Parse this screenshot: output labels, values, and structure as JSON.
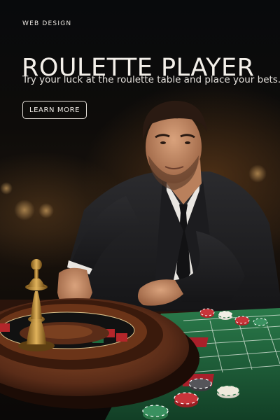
{
  "banner": {
    "eyebrow": "WEB DESIGN",
    "title": "ROULETTE PLAYER",
    "subtitle": "Try your luck at the roulette table and place your bets.",
    "cta_label": "LEARN MORE"
  },
  "colors": {
    "background": "#0b0806",
    "text": "#f4f0ea",
    "felt_green": "#1f6b3e",
    "wheel_wood": "#5a2c18",
    "brass": "#c8963c",
    "chip_red": "#b3262a"
  }
}
